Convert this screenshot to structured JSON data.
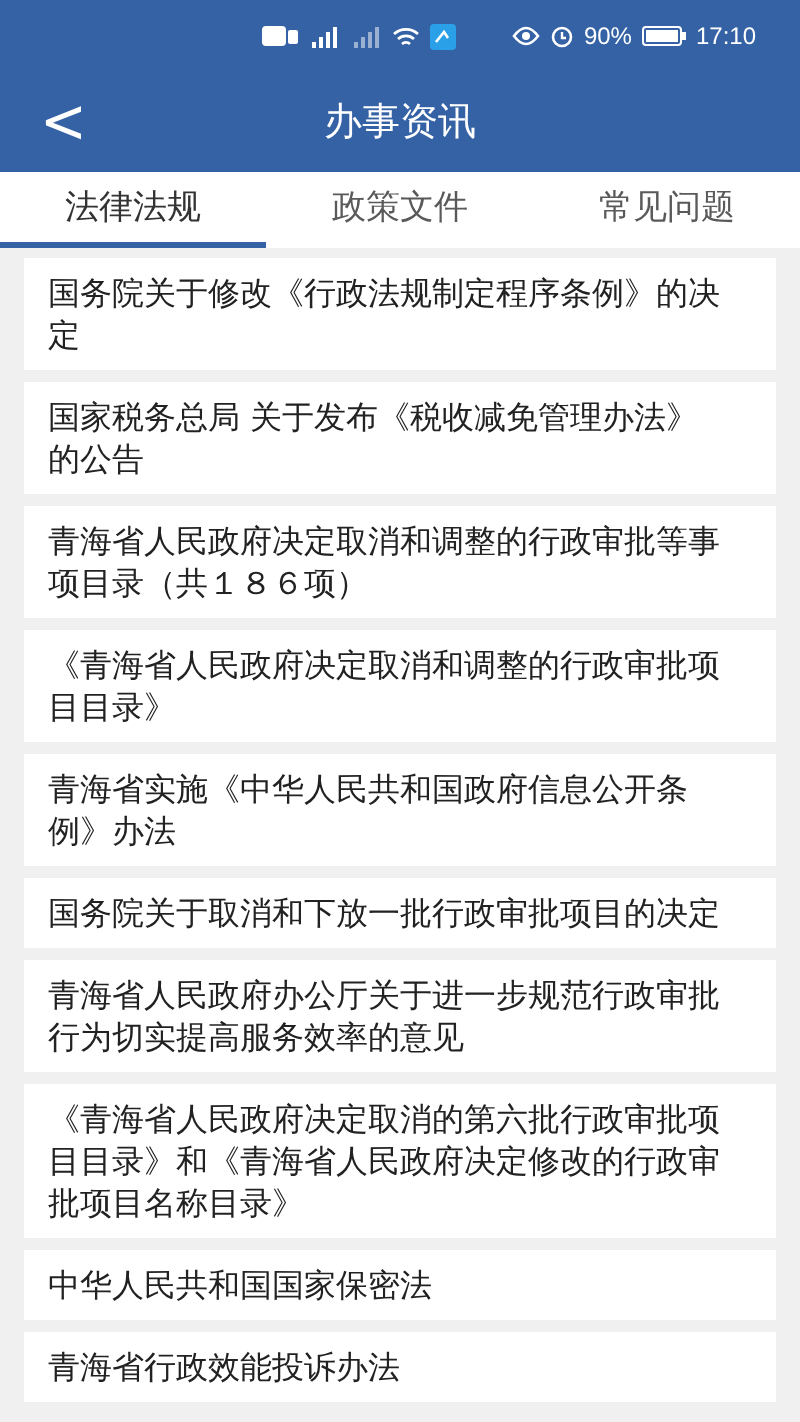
{
  "status_bar": {
    "battery": "90%",
    "time": "17:10"
  },
  "header": {
    "back": "<",
    "title": "办事资讯"
  },
  "tabs": [
    {
      "label": "法律法规",
      "selected": true
    },
    {
      "label": "政策文件",
      "selected": false
    },
    {
      "label": "常见问题",
      "selected": false
    }
  ],
  "items": [
    "国务院关于修改《行政法规制定程序条例》的决定",
    "国家税务总局 关于发布《税收减免管理办法》的公告",
    "青海省人民政府决定取消和调整的行政审批等事项目录（共１８６项）",
    "《青海省人民政府决定取消和调整的行政审批项目目录》",
    "青海省实施《中华人民共和国政府信息公开条例》办法",
    "国务院关于取消和下放一批行政审批项目的决定",
    "青海省人民政府办公厅关于进一步规范行政审批行为切实提高服务效率的意见",
    "《青海省人民政府决定取消的第六批行政审批项目目录》和《青海省人民政府决定修改的行政审批项目名称目录》",
    "中华人民共和国国家保密法",
    "青海省行政效能投诉办法"
  ]
}
